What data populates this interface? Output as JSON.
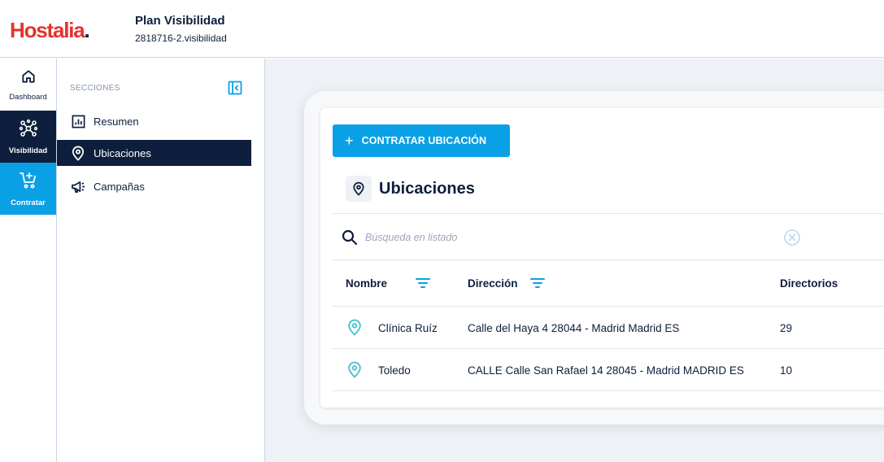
{
  "header": {
    "logo_text": "Hostalia",
    "logo_dot": ".",
    "plan_title": "Plan Visibilidad",
    "plan_id": "2818716-2.visibilidad"
  },
  "nav": {
    "items": [
      {
        "label": "Dashboard",
        "icon": "home-icon"
      },
      {
        "label": "Visibilidad",
        "icon": "network-icon"
      },
      {
        "label": "Contratar",
        "icon": "cart-plus-icon"
      }
    ]
  },
  "sections": {
    "heading": "SECCIONES",
    "items": [
      {
        "label": "Resumen",
        "icon": "chart-icon"
      },
      {
        "label": "Ubicaciones",
        "icon": "location-pin-icon"
      },
      {
        "label": "Campañas",
        "icon": "megaphone-icon"
      }
    ]
  },
  "main": {
    "add_button": "CONTRATAR UBICACIÓN",
    "add_button_icon": "+",
    "title": "Ubicaciones",
    "search_placeholder": "Búsqueda en listado",
    "columns": [
      "Nombre",
      "Dirección",
      "Directorios"
    ],
    "rows": [
      {
        "nombre": "Clínica Ruíz",
        "direccion": "Calle del Haya 4 28044 - Madrid Madrid ES",
        "directorios": "29"
      },
      {
        "nombre": "Toledo",
        "direccion": "CALLE Calle San Rafael 14 28045 - Madrid MADRID ES",
        "directorios": "10"
      }
    ]
  },
  "colors": {
    "brand_red": "#e3342f",
    "navy": "#0d1f3c",
    "accent_blue": "#0aa0e6",
    "pin_teal": "#4cc0cf"
  }
}
